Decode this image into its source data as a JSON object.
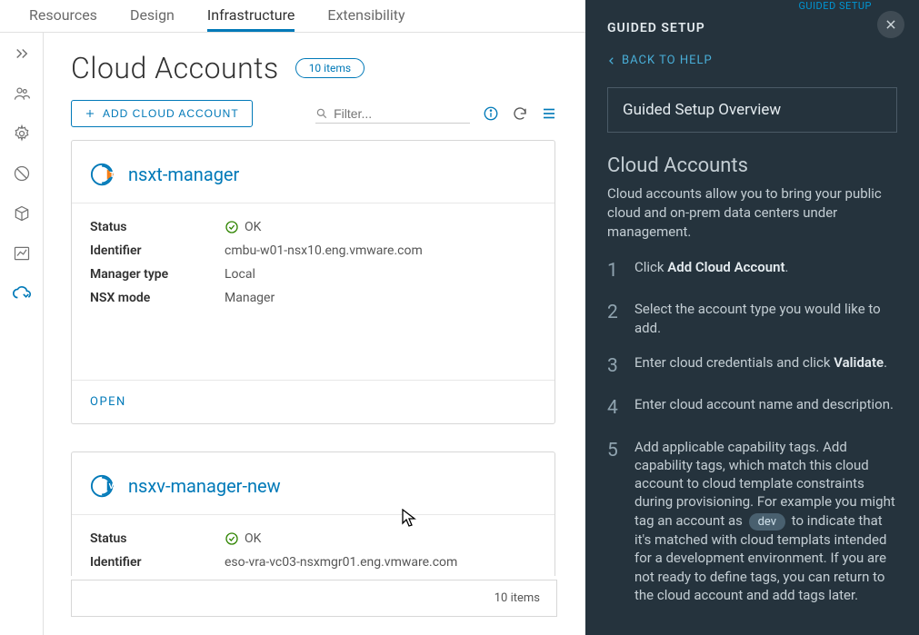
{
  "top_tabs": {
    "resources": "Resources",
    "design": "Design",
    "infrastructure": "Infrastructure",
    "extensibility": "Extensibility"
  },
  "page": {
    "title": "Cloud Accounts",
    "item_count_label": "10 items",
    "add_button": "ADD CLOUD ACCOUNT",
    "filter_placeholder": "Filter...",
    "footer_count": "10 items"
  },
  "labels": {
    "status": "Status",
    "identifier": "Identifier",
    "manager_type": "Manager type",
    "nsx_mode": "NSX mode",
    "open": "OPEN",
    "ok": "OK"
  },
  "cards": [
    {
      "name": "nsxt-manager",
      "icon_letter": "T",
      "status": "OK",
      "identifier": "cmbu-w01-nsx10.eng.vmware.com",
      "manager_type": "Local",
      "nsx_mode": "Manager"
    },
    {
      "name": "nsxv-manager-new",
      "icon_letter": "V",
      "status": "OK",
      "identifier": "eso-vra-vc03-nsxmgr01.eng.vmware.com"
    }
  ],
  "guided": {
    "top_link": "GUIDED SETUP",
    "panel_title": "GUIDED SETUP",
    "back": "BACK TO HELP",
    "overview": "Guided Setup Overview",
    "section_title": "Cloud Accounts",
    "intro": "Cloud accounts allow you to bring your public cloud and on-prem data centers under management.",
    "steps": {
      "s1_a": "Click ",
      "s1_b": "Add Cloud Account",
      "s1_c": ".",
      "s2": "Select the account type you would like to add.",
      "s3_a": "Enter cloud credentials and click ",
      "s3_b": "Validate",
      "s3_c": ".",
      "s4": "Enter cloud account name and description.",
      "s5_a": "Add applicable capability tags. Add capability tags, which match this cloud account to cloud template constraints during provisioning. For example you might tag an account as ",
      "s5_pill": "dev",
      "s5_b": " to indicate that it's matched with cloud templats intended for a development environment. If you are not ready to define tags, you can return to the cloud account and add tags later."
    }
  }
}
